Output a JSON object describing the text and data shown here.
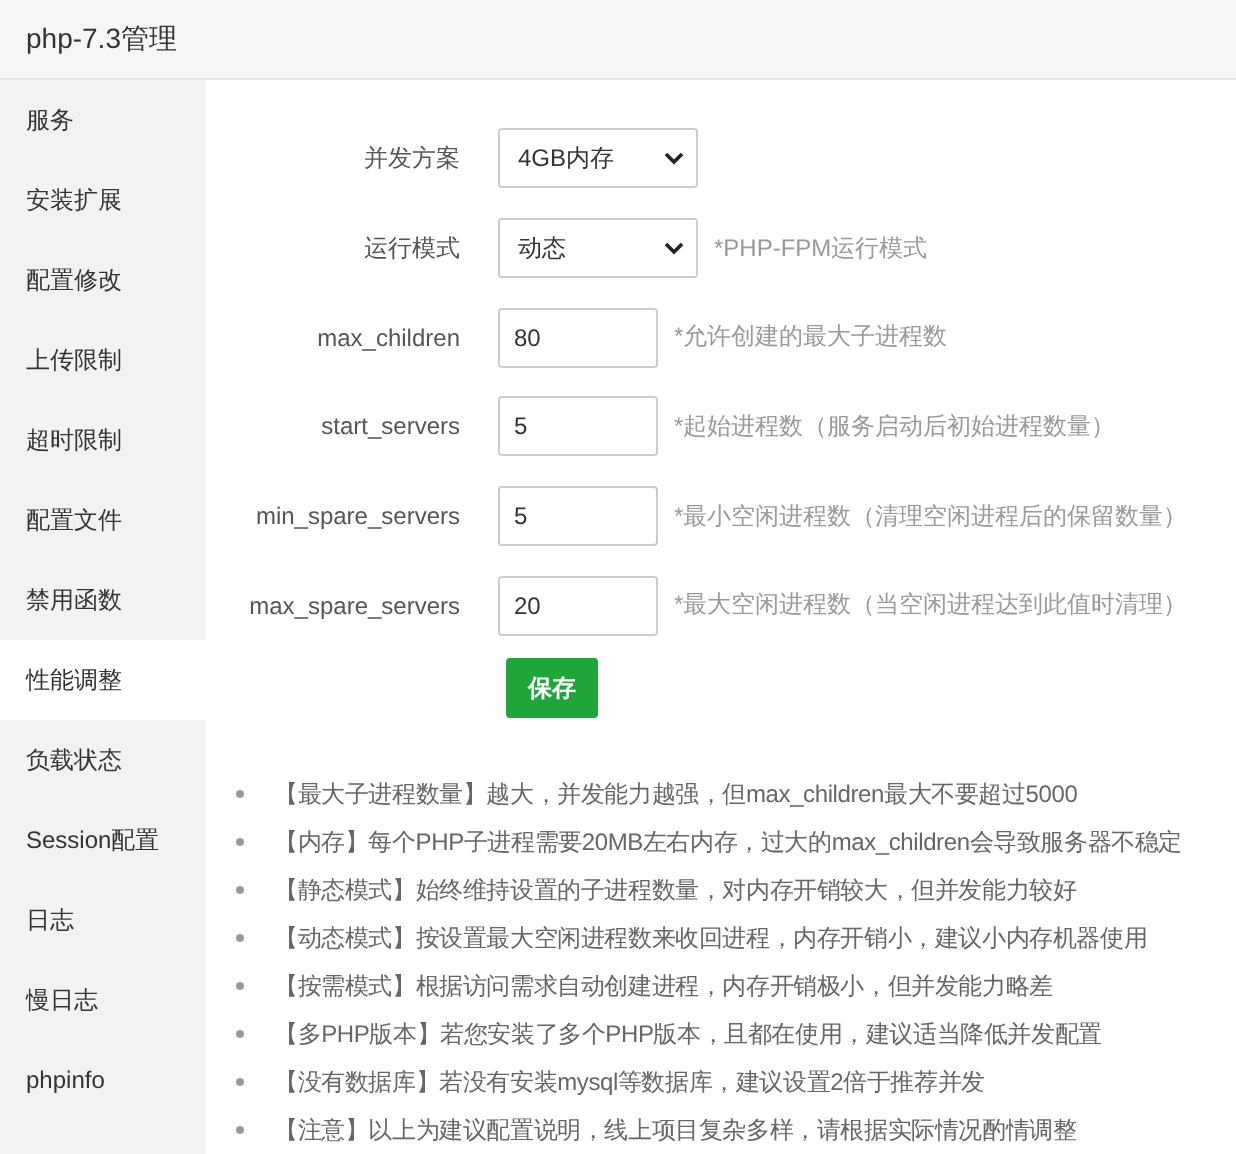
{
  "window": {
    "title": "php-7.3管理"
  },
  "sidebar": {
    "items": [
      {
        "label": "服务",
        "selected": false
      },
      {
        "label": "安装扩展",
        "selected": false
      },
      {
        "label": "配置修改",
        "selected": false
      },
      {
        "label": "上传限制",
        "selected": false
      },
      {
        "label": "超时限制",
        "selected": false
      },
      {
        "label": "配置文件",
        "selected": false
      },
      {
        "label": "禁用函数",
        "selected": false
      },
      {
        "label": "性能调整",
        "selected": true
      },
      {
        "label": "负载状态",
        "selected": false
      },
      {
        "label": "Session配置",
        "selected": false
      },
      {
        "label": "日志",
        "selected": false
      },
      {
        "label": "慢日志",
        "selected": false
      },
      {
        "label": "phpinfo",
        "selected": false
      }
    ]
  },
  "form": {
    "fields": [
      {
        "kind": "select",
        "label": "并发方案",
        "value": "4GB内存"
      },
      {
        "kind": "select",
        "label": "运行模式",
        "value": "动态",
        "hint": "*PHP-FPM运行模式"
      },
      {
        "kind": "input",
        "label": "max_children",
        "value": "80",
        "hint": "*允许创建的最大子进程数"
      },
      {
        "kind": "input",
        "label": "start_servers",
        "value": "5",
        "hint": "*起始进程数（服务启动后初始进程数量）"
      },
      {
        "kind": "input",
        "label": "min_spare_servers",
        "value": "5",
        "hint": "*最小空闲进程数（清理空闲进程后的保留数量）"
      },
      {
        "kind": "input",
        "label": "max_spare_servers",
        "value": "20",
        "hint": "*最大空闲进程数（当空闲进程达到此值时清理）"
      }
    ],
    "save_button": "保存"
  },
  "notes": [
    "【最大子进程数量】越大，并发能力越强，但max_children最大不要超过5000",
    "【内存】每个PHP子进程需要20MB左右内存，过大的max_children会导致服务器不稳定",
    "【静态模式】始终维持设置的子进程数量，对内存开销较大，但并发能力较好",
    "【动态模式】按设置最大空闲进程数来收回进程，内存开销小，建议小内存机器使用",
    "【按需模式】根据访问需求自动创建进程，内存开销极小，但并发能力略差",
    "【多PHP版本】若您安装了多个PHP版本，且都在使用，建议适当降低并发配置",
    "【没有数据库】若没有安装mysql等数据库，建议设置2倍于推荐并发",
    "【注意】以上为建议配置说明，线上项目复杂多样，请根据实际情况酌情调整"
  ]
}
